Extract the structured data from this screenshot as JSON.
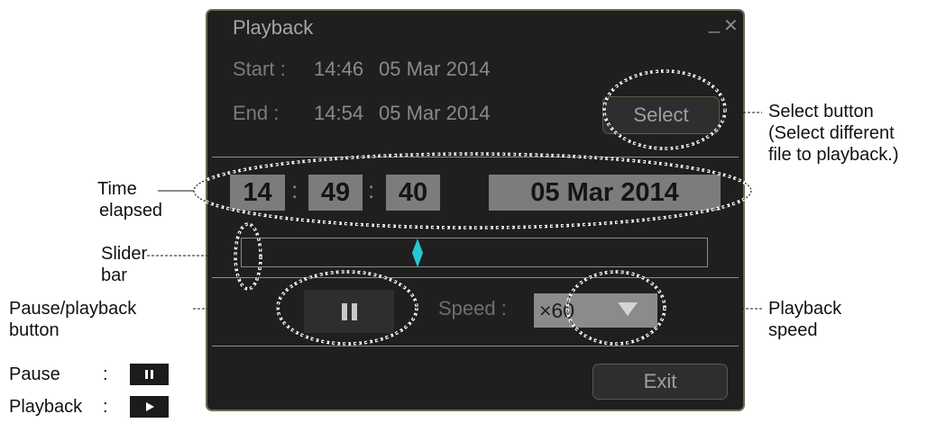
{
  "dialog": {
    "title": "Playback",
    "start_label": "Start :",
    "start_time": "14:46",
    "start_date": "05 Mar 2014",
    "end_label": "End :",
    "end_time": "14:54",
    "end_date": "05 Mar 2014",
    "select_label": "Select",
    "elapsed": {
      "hours": "14",
      "minutes": "49",
      "seconds": "40",
      "separator": ":",
      "date": "05 Mar 2014"
    },
    "slider_position": 0.36,
    "speed_label": "Speed :",
    "speed_value": "×60",
    "exit_label": "Exit",
    "icons": [
      "minimize-icon",
      "close-icon",
      "pause-icon",
      "chevron-down-icon",
      "slider-thumb-icon"
    ]
  },
  "annotations": {
    "select_button": [
      "Select button",
      "(Select different",
      "file to playback.)"
    ],
    "time_elapsed": [
      "Time",
      "elapsed"
    ],
    "slider_bar": [
      "Slider",
      "bar"
    ],
    "pause_playback": [
      "Pause/playback",
      "button"
    ],
    "playback_speed": [
      "Playback",
      "speed"
    ],
    "legend": [
      {
        "label": "Pause",
        "sep": ":",
        "icon": "pause-icon"
      },
      {
        "label": "Playback",
        "sep": ":",
        "icon": "play-icon"
      }
    ]
  },
  "colors": {
    "dialog_bg": "#1e1f1e",
    "dialog_border": "#6f6a55",
    "text_gray": "#8a8a8a",
    "field_gray": "#7c7c7c",
    "slider_thumb": "#26c6d6",
    "annotation_text": "#111111"
  }
}
